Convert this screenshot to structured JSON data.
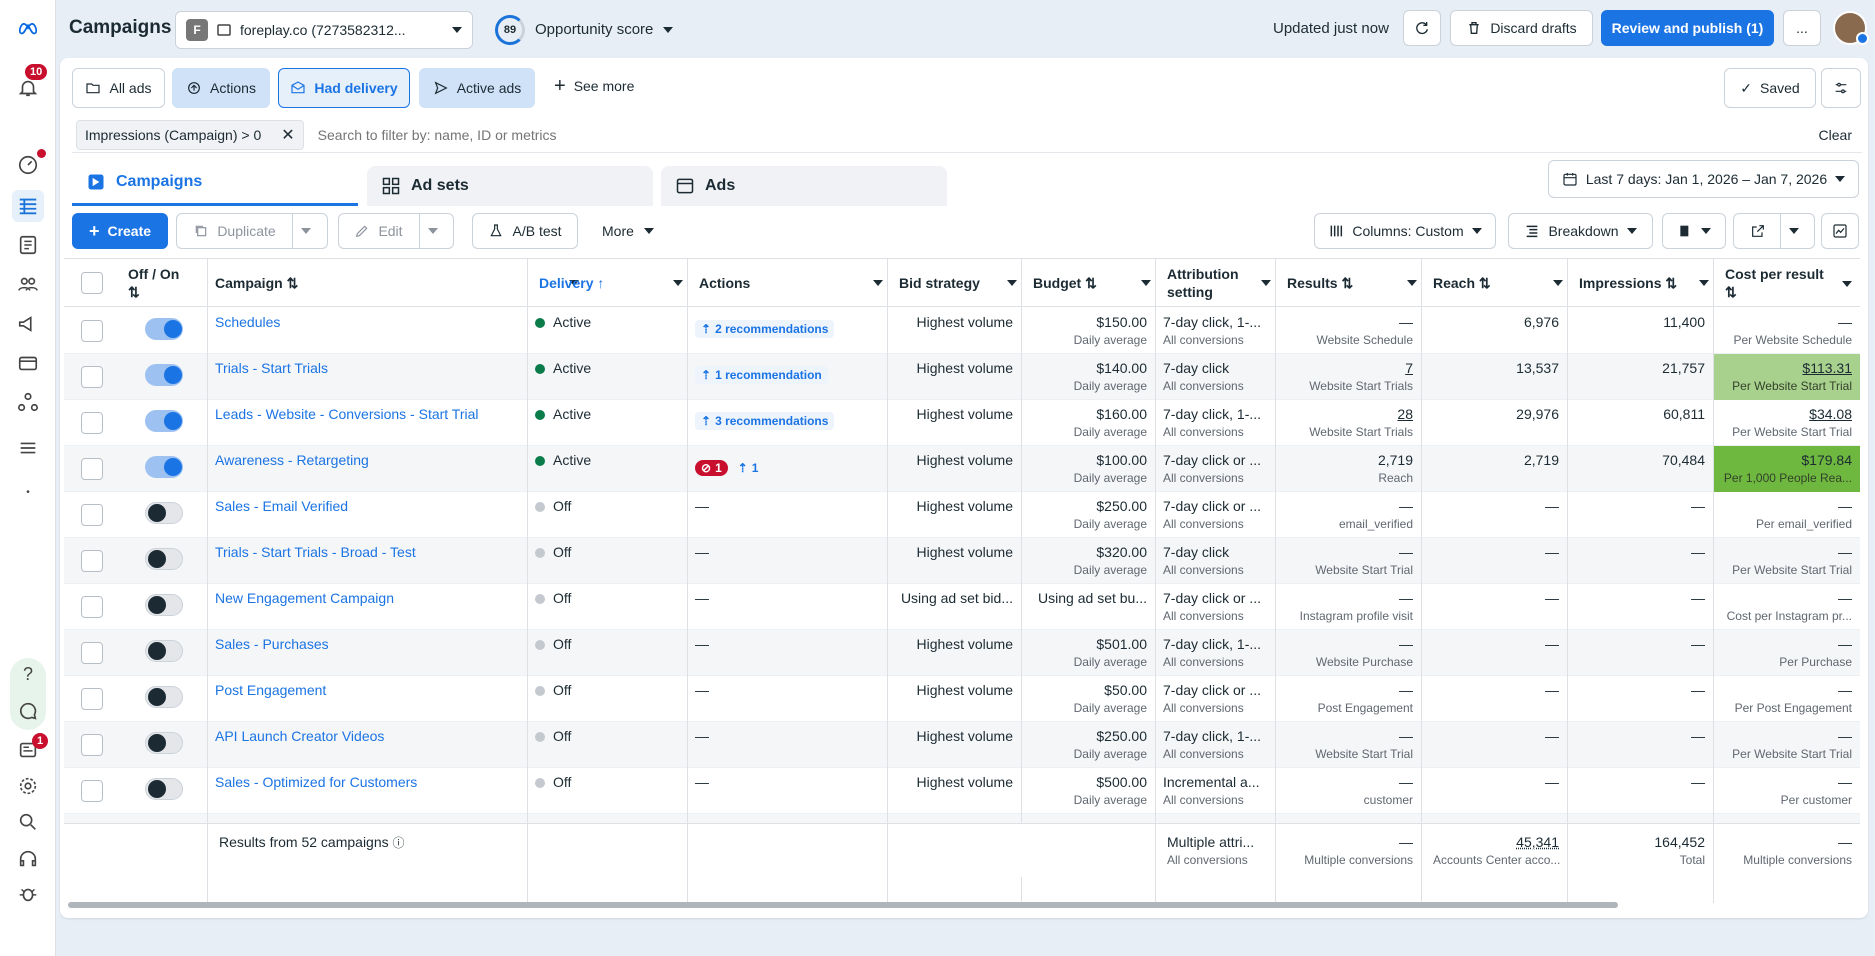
{
  "app": {
    "title": "Campaigns",
    "account": "foreplay.co (7273582312...",
    "account_initial": "F",
    "score_value": "89",
    "score_label": "Opportunity score",
    "updated": "Updated just now",
    "notif_count": "10",
    "help_badge": "1"
  },
  "top_actions": {
    "discard": "Discard drafts",
    "publish": "Review and publish (1)",
    "more": "..."
  },
  "quickviews": {
    "all_ads": "All ads",
    "actions": "Actions",
    "had_delivery": "Had delivery",
    "active_ads": "Active ads",
    "see_more": "See more",
    "saved": "Saved"
  },
  "filter": {
    "chip": "Impressions (Campaign) > 0",
    "placeholder": "Search to filter by: name, ID or metrics",
    "clear": "Clear",
    "date_range": "Last 7 days: Jan 1, 2026 – Jan 7, 2026"
  },
  "tabs": [
    {
      "label": "Campaigns"
    },
    {
      "label": "Ad sets"
    },
    {
      "label": "Ads"
    }
  ],
  "toolbar": {
    "create": "Create",
    "duplicate": "Duplicate",
    "edit": "Edit",
    "ab_test": "A/B test",
    "more": "More",
    "columns": "Columns: Custom",
    "breakdown": "Breakdown"
  },
  "headers": {
    "offon": "Off / On",
    "campaign": "Campaign",
    "delivery": "Delivery",
    "actions": "Actions",
    "bid": "Bid strategy",
    "budget": "Budget",
    "attribution": "Attribution setting",
    "results": "Results",
    "reach": "Reach",
    "impressions": "Impressions",
    "cpr": "Cost per result"
  },
  "rows": [
    {
      "name": "Schedules",
      "on": true,
      "delivery": "Active",
      "actions": "2 recommendations",
      "bid": "Highest volume",
      "budget": "$150.00",
      "budget_sub": "Daily average",
      "attr": "7-day click, 1-...",
      "attr_sub": "All conversions",
      "results": "—",
      "results_sub": "Website Schedule",
      "reach": "6,976",
      "impr": "11,400",
      "cpr": "—",
      "cpr_sub": "Per Website Schedule",
      "hl": ""
    },
    {
      "name": "Trials - Start Trials",
      "on": true,
      "delivery": "Active",
      "actions": "1 recommendation",
      "bid": "Highest volume",
      "budget": "$140.00",
      "budget_sub": "Daily average",
      "attr": "7-day click",
      "attr_sub": "All conversions",
      "results": "7",
      "results_sub": "Website Start Trials",
      "reach": "13,537",
      "impr": "21,757",
      "cpr": "$113.31",
      "cpr_sub": "Per Website Start Trial",
      "hl": "#a9d18e"
    },
    {
      "name": "Leads - Website - Conversions - Start Trial",
      "on": true,
      "delivery": "Active",
      "actions": "3 recommendations",
      "bid": "Highest volume",
      "budget": "$160.00",
      "budget_sub": "Daily average",
      "attr": "7-day click, 1-...",
      "attr_sub": "All conversions",
      "results": "28",
      "results_sub": "Website Start Trials",
      "reach": "29,976",
      "impr": "60,811",
      "cpr": "$34.08",
      "cpr_sub": "Per Website Start Trial",
      "hl": ""
    },
    {
      "name": "Awareness - Retargeting",
      "on": true,
      "delivery": "Active",
      "actions": "1",
      "error_count": "1",
      "bid": "Highest volume",
      "budget": "$100.00",
      "budget_sub": "Daily average",
      "attr": "7-day click or ...",
      "attr_sub": "All conversions",
      "results": "2,719",
      "results_sub": "Reach",
      "reach": "2,719",
      "impr": "70,484",
      "cpr": "$179.84",
      "cpr_sub": "Per 1,000 People Rea...",
      "hl": "#6fb83f"
    },
    {
      "name": "Sales - Email Verified",
      "on": false,
      "delivery": "Off",
      "actions": "—",
      "bid": "Highest volume",
      "budget": "$250.00",
      "budget_sub": "Daily average",
      "attr": "7-day click or ...",
      "attr_sub": "All conversions",
      "results": "—",
      "results_sub": "email_verified",
      "reach": "—",
      "impr": "—",
      "cpr": "—",
      "cpr_sub": "Per email_verified",
      "hl": ""
    },
    {
      "name": "Trials - Start Trials - Broad - Test",
      "on": false,
      "delivery": "Off",
      "actions": "—",
      "bid": "Highest volume",
      "budget": "$320.00",
      "budget_sub": "Daily average",
      "attr": "7-day click",
      "attr_sub": "All conversions",
      "results": "—",
      "results_sub": "Website Start Trial",
      "reach": "—",
      "impr": "—",
      "cpr": "—",
      "cpr_sub": "Per Website Start Trial",
      "hl": ""
    },
    {
      "name": "New Engagement Campaign",
      "on": false,
      "delivery": "Off",
      "actions": "—",
      "bid": "Using ad set bid...",
      "budget": "Using ad set bu...",
      "budget_sub": "",
      "attr": "7-day click or ...",
      "attr_sub": "All conversions",
      "results": "—",
      "results_sub": "Instagram profile visit",
      "reach": "—",
      "impr": "—",
      "cpr": "—",
      "cpr_sub": "Cost per Instagram pr...",
      "hl": ""
    },
    {
      "name": "Sales - Purchases",
      "on": false,
      "delivery": "Off",
      "actions": "—",
      "bid": "Highest volume",
      "budget": "$501.00",
      "budget_sub": "Daily average",
      "attr": "7-day click, 1-...",
      "attr_sub": "All conversions",
      "results": "—",
      "results_sub": "Website Purchase",
      "reach": "—",
      "impr": "—",
      "cpr": "—",
      "cpr_sub": "Per Purchase",
      "hl": ""
    },
    {
      "name": "Post Engagement",
      "on": false,
      "delivery": "Off",
      "actions": "—",
      "bid": "Highest volume",
      "budget": "$50.00",
      "budget_sub": "Daily average",
      "attr": "7-day click or ...",
      "attr_sub": "All conversions",
      "results": "—",
      "results_sub": "Post Engagement",
      "reach": "—",
      "impr": "—",
      "cpr": "—",
      "cpr_sub": "Per Post Engagement",
      "hl": ""
    },
    {
      "name": "API Launch Creator Videos",
      "on": false,
      "delivery": "Off",
      "actions": "—",
      "bid": "Highest volume",
      "budget": "$250.00",
      "budget_sub": "Daily average",
      "attr": "7-day click, 1-...",
      "attr_sub": "All conversions",
      "results": "—",
      "results_sub": "Website Start Trial",
      "reach": "—",
      "impr": "—",
      "cpr": "—",
      "cpr_sub": "Per Website Start Trial",
      "hl": ""
    },
    {
      "name": "Sales - Optimized for Customers",
      "on": false,
      "delivery": "Off",
      "actions": "—",
      "bid": "Highest volume",
      "budget": "$500.00",
      "budget_sub": "Daily average",
      "attr": "Incremental a...",
      "attr_sub": "All conversions",
      "results": "—",
      "results_sub": "customer",
      "reach": "—",
      "impr": "—",
      "cpr": "—",
      "cpr_sub": "Per customer",
      "hl": ""
    }
  ],
  "summary": {
    "label": "Results from 52 campaigns",
    "attr": "Multiple attri...",
    "attr_sub": "All conversions",
    "results": "—",
    "results_sub": "Multiple conversions",
    "reach": "45,341",
    "reach_sub": "Accounts Center acco...",
    "impr": "164,452",
    "impr_sub": "Total",
    "cpr": "—",
    "cpr_sub": "Multiple conversions"
  },
  "colors": {
    "accent": "#1b74e4",
    "active": "#0a7c4a",
    "off": "#c4c9cf",
    "error": "#c8102e"
  }
}
